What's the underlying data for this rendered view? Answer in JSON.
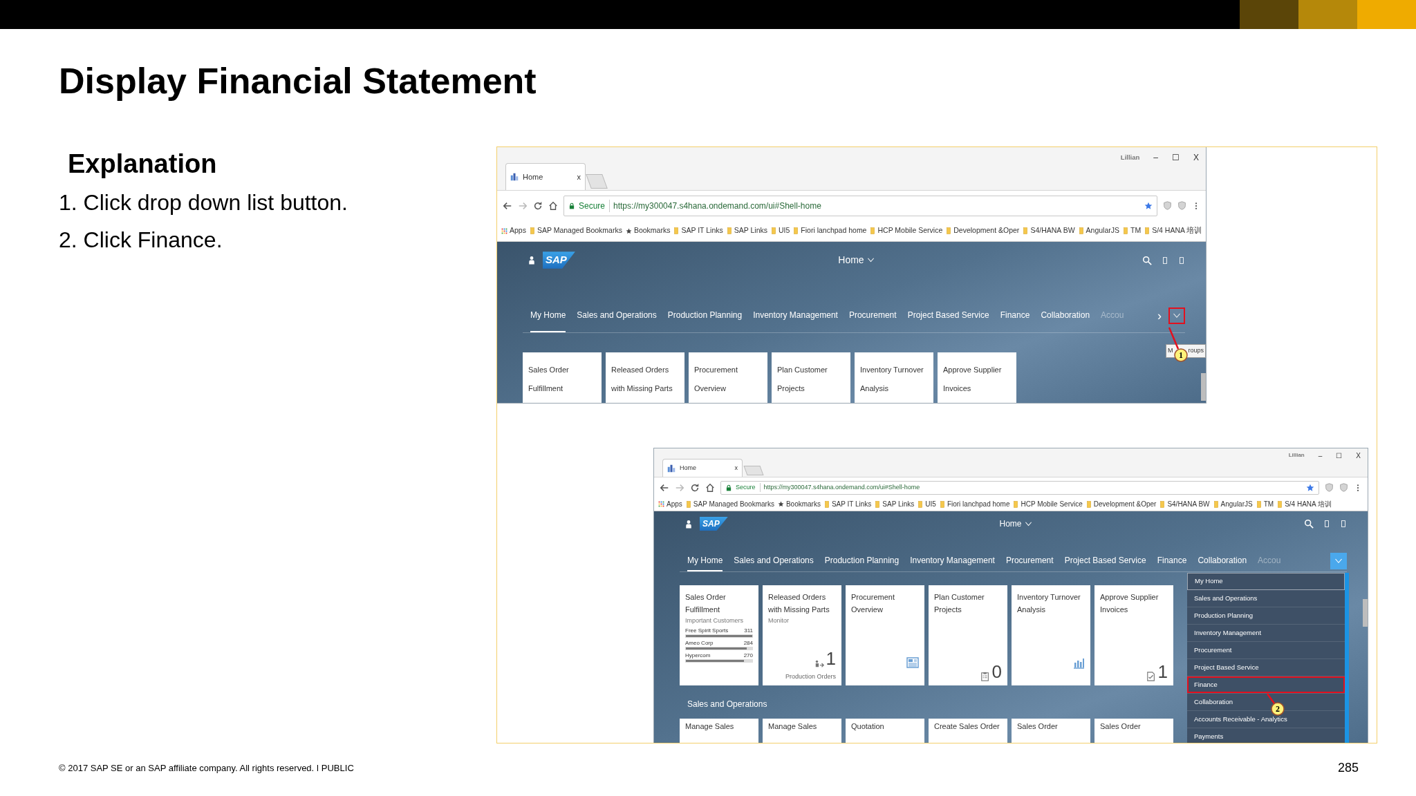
{
  "slide": {
    "title": "Display Financial Statement",
    "section_heading": "Explanation",
    "steps": [
      "1. Click drop down list button.",
      "2. Click Finance."
    ],
    "footer": "© 2017 SAP SE or an SAP affiliate company. All rights reserved.  ǀ  PUBLIC",
    "page_number": "285"
  },
  "screenshots": [
    {
      "tab_title": "Home",
      "tab_close": "x",
      "user": "Lillian",
      "window_controls": [
        "–",
        "☐",
        "X"
      ],
      "secure_label": "Secure",
      "url": "https://my300047.s4hana.ondemand.com/ui#Shell-home",
      "bookmarks": [
        {
          "label": "Apps",
          "kind": "apps"
        },
        {
          "label": "SAP Managed Bookmarks",
          "kind": "folder"
        },
        {
          "label": "Bookmarks",
          "kind": "star"
        },
        {
          "label": "SAP IT Links",
          "kind": "folder"
        },
        {
          "label": "SAP Links",
          "kind": "folder"
        },
        {
          "label": "UI5",
          "kind": "folder"
        },
        {
          "label": "Fiori lanchpad home",
          "kind": "folder"
        },
        {
          "label": "HCP  Mobile Service",
          "kind": "folder"
        },
        {
          "label": "Development &Oper",
          "kind": "folder"
        },
        {
          "label": "S4/HANA BW",
          "kind": "folder"
        },
        {
          "label": "AngularJS",
          "kind": "folder"
        },
        {
          "label": "TM",
          "kind": "folder"
        },
        {
          "label": "S/4 HANA 培训",
          "kind": "folder"
        }
      ],
      "shell": {
        "logo": "SAP",
        "home_title": "Home",
        "nav": [
          {
            "label": "My Home",
            "selected": true,
            "faded": false
          },
          {
            "label": "Sales and Operations",
            "selected": false,
            "faded": false
          },
          {
            "label": "Production Planning",
            "selected": false,
            "faded": false
          },
          {
            "label": "Inventory Management",
            "selected": false,
            "faded": false
          },
          {
            "label": "Procurement",
            "selected": false,
            "faded": false
          },
          {
            "label": "Project Based Service",
            "selected": false,
            "faded": false
          },
          {
            "label": "Finance",
            "selected": false,
            "faded": false
          },
          {
            "label": "Collaboration",
            "selected": false,
            "faded": false
          },
          {
            "label": "Accou",
            "selected": false,
            "faded": true
          }
        ],
        "overflow_arrow": "›",
        "menu_button": {
          "highlighted": true,
          "pressed": false
        },
        "tooltip": [
          "M",
          "roups"
        ],
        "tiles": [
          {
            "title_lines": [
              "Sales Order",
              "Fulfillment"
            ]
          },
          {
            "title_lines": [
              "Released Orders",
              "with Missing Parts"
            ]
          },
          {
            "title_lines": [
              "Procurement",
              "Overview"
            ]
          },
          {
            "title_lines": [
              "Plan Customer",
              "Projects"
            ]
          },
          {
            "title_lines": [
              "Inventory Turnover",
              "Analysis"
            ]
          },
          {
            "title_lines": [
              "Approve Supplier",
              "Invoices"
            ]
          }
        ]
      }
    },
    {
      "tab_title": "Home",
      "tab_close": "x",
      "user": "Lillian",
      "window_controls": [
        "–",
        "☐",
        "X"
      ],
      "secure_label": "Secure",
      "url": "https://my300047.s4hana.ondemand.com/ui#Shell-home",
      "bookmarks": [
        {
          "label": "Apps",
          "kind": "apps"
        },
        {
          "label": "SAP Managed Bookmarks",
          "kind": "folder"
        },
        {
          "label": "Bookmarks",
          "kind": "star"
        },
        {
          "label": "SAP IT Links",
          "kind": "folder"
        },
        {
          "label": "SAP Links",
          "kind": "folder"
        },
        {
          "label": "UI5",
          "kind": "folder"
        },
        {
          "label": "Fiori lanchpad home",
          "kind": "folder"
        },
        {
          "label": "HCP  Mobile Service",
          "kind": "folder"
        },
        {
          "label": "Development &Oper",
          "kind": "folder"
        },
        {
          "label": "S4/HANA BW",
          "kind": "folder"
        },
        {
          "label": "AngularJS",
          "kind": "folder"
        },
        {
          "label": "TM",
          "kind": "folder"
        },
        {
          "label": "S/4 HANA 培训",
          "kind": "folder"
        }
      ],
      "shell": {
        "logo": "SAP",
        "home_title": "Home",
        "nav": [
          {
            "label": "My Home",
            "selected": true,
            "faded": false
          },
          {
            "label": "Sales and Operations",
            "selected": false,
            "faded": false
          },
          {
            "label": "Production Planning",
            "selected": false,
            "faded": false
          },
          {
            "label": "Inventory Management",
            "selected": false,
            "faded": false
          },
          {
            "label": "Procurement",
            "selected": false,
            "faded": false
          },
          {
            "label": "Project Based Service",
            "selected": false,
            "faded": false
          },
          {
            "label": "Finance",
            "selected": false,
            "faded": false
          },
          {
            "label": "Collaboration",
            "selected": false,
            "faded": false
          },
          {
            "label": "Accou",
            "selected": false,
            "faded": true
          }
        ],
        "menu_button": {
          "highlighted": false,
          "pressed": true
        },
        "tiles": [
          {
            "kind": "bars",
            "title_lines": [
              "Sales Order",
              "Fulfillment"
            ],
            "subtitle": "Important Customers",
            "bars": [
              {
                "name": "Free Spirit Sports",
                "value": "311",
                "level": 1.0
              },
              {
                "name": "Ameo Corp",
                "value": "284",
                "level": 0.92
              },
              {
                "name": "Hypercom",
                "value": "270",
                "level": 0.88
              }
            ]
          },
          {
            "kind": "number",
            "title_lines": [
              "Released Orders",
              "with Missing Parts"
            ],
            "subtitle": "Monitor",
            "value": "1",
            "footer": "Production Orders"
          },
          {
            "kind": "icon",
            "title_lines": [
              "Procurement",
              "Overview"
            ]
          },
          {
            "kind": "number",
            "title_lines": [
              "Plan Customer",
              "Projects"
            ],
            "value": "0"
          },
          {
            "kind": "icon",
            "title_lines": [
              "Inventory Turnover",
              "Analysis"
            ]
          },
          {
            "kind": "number",
            "title_lines": [
              "Approve Supplier",
              "Invoices"
            ],
            "value": "1"
          }
        ],
        "section_title": "Sales and Operations",
        "tiles_2": [
          {
            "title_lines": [
              "Manage Sales"
            ]
          },
          {
            "title_lines": [
              "Manage Sales"
            ]
          },
          {
            "title_lines": [
              "Quotation"
            ]
          },
          {
            "title_lines": [
              "Create Sales Order"
            ]
          },
          {
            "title_lines": [
              "Sales Order"
            ]
          },
          {
            "title_lines": [
              "Sales Order"
            ]
          }
        ],
        "menu": [
          {
            "label": "My Home",
            "selected": true,
            "highlighted": false
          },
          {
            "label": "Sales and Operations",
            "selected": false,
            "highlighted": false
          },
          {
            "label": "Production Planning",
            "selected": false,
            "highlighted": false
          },
          {
            "label": "Inventory Management",
            "selected": false,
            "highlighted": false
          },
          {
            "label": "Procurement",
            "selected": false,
            "highlighted": false
          },
          {
            "label": "Project Based Service",
            "selected": false,
            "highlighted": false
          },
          {
            "label": "Finance",
            "selected": false,
            "highlighted": true
          },
          {
            "label": "Collaboration",
            "selected": false,
            "highlighted": false
          },
          {
            "label": "Accounts Receivable - Analytics",
            "selected": false,
            "highlighted": false
          },
          {
            "label": "Payments",
            "selected": false,
            "highlighted": false
          }
        ]
      }
    }
  ],
  "callouts": [
    {
      "number": "1"
    },
    {
      "number": "2"
    }
  ]
}
